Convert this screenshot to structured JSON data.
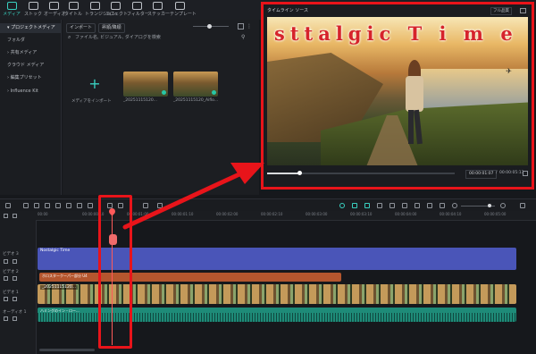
{
  "toolbar": {
    "tools": [
      {
        "label": "メディア",
        "active": true
      },
      {
        "label": "ストック"
      },
      {
        "label": "オーディオ"
      },
      {
        "label": "タイトル"
      },
      {
        "label": "トランジション"
      },
      {
        "label": "エフェクト"
      },
      {
        "label": "フィルター"
      },
      {
        "label": "ステッカー"
      },
      {
        "label": "テンプレート"
      }
    ]
  },
  "sidebar": {
    "items": [
      {
        "label": "▾ プロジェクトメディア"
      },
      {
        "label": "フォルダ"
      },
      {
        "label": "› 共有メディア"
      },
      {
        "label": "クラウド メディア"
      },
      {
        "label": "› 編集プリセット"
      },
      {
        "label": "› Influence Kit"
      }
    ]
  },
  "media": {
    "import_label": "インポート",
    "sort_label": "昇順/降順",
    "search_placeholder": "ファイル名, ビジュアル, ダイアログを検索",
    "import_tile_label": "メディアをインポート",
    "tiles": [
      {
        "name": "_20251115120..."
      },
      {
        "name": "_20251115120_Aiflo..."
      }
    ]
  },
  "player": {
    "header": "タイムライン  ソース",
    "quality": "フル品質",
    "overlay_title": "sttalgic T i m e",
    "current_time": "00:00:01:07",
    "total_time": "00:00:05:13",
    "progress": 0.17
  },
  "timeline": {
    "ruler_labels": [
      "00:00",
      "00:00:00:10",
      "00:00:01:00",
      "00:00:01:10",
      "00:00:02:00",
      "00:00:02:10",
      "00:00:03:00",
      "00:00:03:10",
      "00:00:04:00",
      "00:00:04:10",
      "00:00:05:00"
    ],
    "tracks": {
      "video3": "ビデオ 3",
      "video2": "ビデオ 2",
      "video1": "ビデオ 1",
      "audio1": "オーディオ 1"
    },
    "clips": {
      "title": "Nostalgic Time",
      "effect": "ホロスタークーパー部分 U4",
      "video": "_20251115120...",
      "audio": "ハミングのイン・ロー..."
    }
  },
  "colors": {
    "accent": "#39d0c0",
    "highlight": "#e8141a",
    "title_clip": "#4a55b8",
    "effect_clip": "#b4562e",
    "audio_clip": "#1e8b78",
    "playhead": "#ff5a5a"
  }
}
